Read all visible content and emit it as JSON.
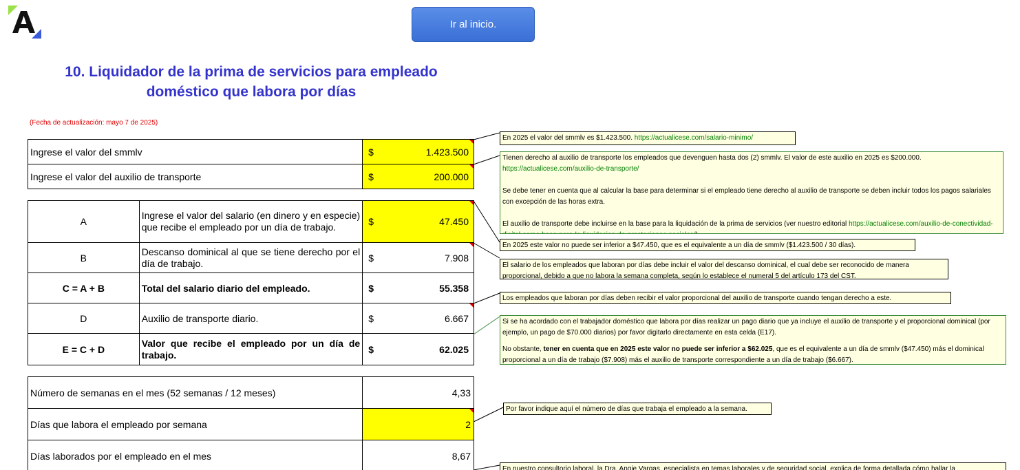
{
  "header": {
    "home_button": "Ir al inicio.",
    "title_line1": "10. Liquidador de la prima de servicios para empleado",
    "title_line2": "doméstico que labora por días",
    "update_date": "(Fecha de actualización: mayo 7 de 2025)"
  },
  "inputs": {
    "smmlv_label": "Ingrese el valor del smmlv",
    "smmlv_currency": "$",
    "smmlv_value": "1.423.500",
    "transport_label": "Ingrese el valor del auxilio de transporte",
    "transport_currency": "$",
    "transport_value": "200.000"
  },
  "daily": {
    "rows": [
      {
        "code": "A",
        "desc": "Ingrese el valor del salario (en dinero y en especie) que recibe el empleado por un día de trabajo.",
        "currency": "$",
        "value": "47.450"
      },
      {
        "code": "B",
        "desc": "Descanso dominical al que se tiene derecho por el día de trabajo.",
        "currency": "$",
        "value": "7.908"
      },
      {
        "code": "C = A + B",
        "desc": "Total del salario diario del empleado.",
        "currency": "$",
        "value": "55.358"
      },
      {
        "code": "D",
        "desc": "Auxilio de transporte diario.",
        "currency": "$",
        "value": "6.667"
      },
      {
        "code": "E = C + D",
        "desc": "Valor que recibe el empleado por un día de trabajo.",
        "currency": "$",
        "value": "62.025"
      }
    ]
  },
  "weeks": {
    "rows": [
      {
        "label": "Número de semanas en el mes (52 semanas / 12 meses)",
        "value": "4,33"
      },
      {
        "label": "Días que labora el empleado por semana",
        "value": "2"
      },
      {
        "label": "Días laborados por el empleado en el mes",
        "value": "8,67"
      }
    ]
  },
  "notes": {
    "n1_text": "En 2025 el valor del smmlv es $1.423.500. ",
    "n1_link": "https://actualicese.com/salario-minimo/",
    "n2_p1": "Tienen derecho al auxilio de transporte los empleados que devenguen hasta dos (2) smmlv. El valor de este auxilio en 2025 es $200.000.",
    "n2_link1": "https://actualicese.com/auxilio-de-transporte/",
    "n2_p2": "Se debe tener en cuenta que al calcular la base para determinar si el empleado tiene derecho al auxilio de transporte se deben incluir todos los pagos salariales con excepción de las horas extra.",
    "n2_p3": "El auxilio de transporte debe incluirse en la base para la liquidación de la prima de servicios (ver nuestro editorial ",
    "n2_link2": "https://actualicese.com/auxilio-de-conectividad-digital-como-base-para-la-liquidacion-de-prestaciones-sociales/",
    "n2_p3_end": ").",
    "n3": "En 2025 este valor no puede ser inferior a $47.450, que es el equivalente a un día de smmlv ($1.423.500 / 30 días).",
    "n4": "El salario de los empleados que laboran por días debe incluir el valor del descanso dominical, el cual debe ser reconocido de manera proporcional, debido a que no labora la semana completa, según lo establece el numeral 5 del artículo 173 del CST.",
    "n5": "Los empleados que laboran por días deben recibir el valor proporcional del auxilio de transporte cuando tengan derecho a este.",
    "n6_p1": "Si se ha acordado con el trabajador doméstico que labora por días realizar un pago diario que ya incluye el auxilio de transporte y el proporcional dominical (por ejemplo, un pago de $70.000 diarios) por favor digitarlo directamente en esta celda (E17).",
    "n6_p2_a": "No obstante, ",
    "n6_p2_b": "tener en cuenta que en 2025 este valor no puede ser inferior a $62.025",
    "n6_p2_c": ", que es el equivalente a un día de smmlv ($47.450) más el dominical proporcional a un día de trabajo ($7.908) más el auxilio de transporte correspondiente a un día de trabajo ($6.667).",
    "n7": "Por favor indique aquí el número de días que trabaja el empleado a la semana.",
    "n8": "En nuestro consultorio laboral, la Dra. Angie Vargas, especialista en temas laborales y de seguridad social, explica de forma detallada cómo hallar la"
  }
}
